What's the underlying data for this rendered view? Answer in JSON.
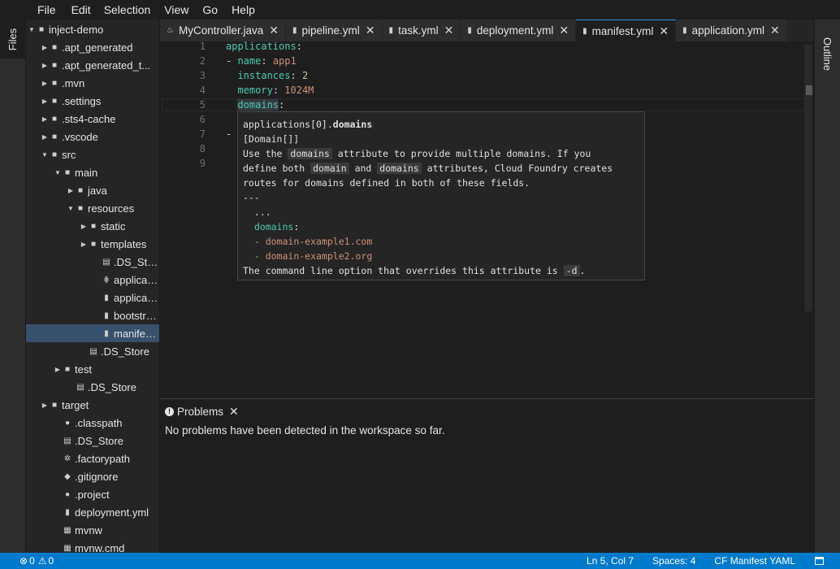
{
  "menu": [
    "File",
    "Edit",
    "Selection",
    "View",
    "Go",
    "Help"
  ],
  "left_rail": {
    "label": "Files"
  },
  "right_rail": {
    "label": "Outline"
  },
  "explorer": {
    "items": [
      {
        "label": "inject-demo",
        "depth": 0,
        "twisty": "open",
        "icon": "folder"
      },
      {
        "label": ".apt_generated",
        "depth": 1,
        "twisty": "closed",
        "icon": "folder"
      },
      {
        "label": ".apt_generated_t...",
        "depth": 1,
        "twisty": "closed",
        "icon": "folder"
      },
      {
        "label": ".mvn",
        "depth": 1,
        "twisty": "closed",
        "icon": "folder"
      },
      {
        "label": ".settings",
        "depth": 1,
        "twisty": "closed",
        "icon": "folder"
      },
      {
        "label": ".sts4-cache",
        "depth": 1,
        "twisty": "closed",
        "icon": "folder"
      },
      {
        "label": ".vscode",
        "depth": 1,
        "twisty": "closed",
        "icon": "folder"
      },
      {
        "label": "src",
        "depth": 1,
        "twisty": "open",
        "icon": "folder"
      },
      {
        "label": "main",
        "depth": 2,
        "twisty": "open",
        "icon": "folder"
      },
      {
        "label": "java",
        "depth": 3,
        "twisty": "closed",
        "icon": "folder"
      },
      {
        "label": "resources",
        "depth": 3,
        "twisty": "open",
        "icon": "folder"
      },
      {
        "label": "static",
        "depth": 4,
        "twisty": "closed",
        "icon": "folder"
      },
      {
        "label": "templates",
        "depth": 4,
        "twisty": "closed",
        "icon": "folder"
      },
      {
        "label": ".DS_Store",
        "depth": 5,
        "twisty": "",
        "icon": "file"
      },
      {
        "label": "applicati...",
        "depth": 5,
        "twisty": "",
        "icon": "settings-file"
      },
      {
        "label": "applicati...",
        "depth": 5,
        "twisty": "",
        "icon": "db-file"
      },
      {
        "label": "bootstra...",
        "depth": 5,
        "twisty": "",
        "icon": "db-file"
      },
      {
        "label": "manifest....",
        "depth": 5,
        "twisty": "",
        "icon": "db-file",
        "selected": true
      },
      {
        "label": ".DS_Store",
        "depth": 4,
        "twisty": "",
        "icon": "file"
      },
      {
        "label": "test",
        "depth": 2,
        "twisty": "closed",
        "icon": "folder"
      },
      {
        "label": ".DS_Store",
        "depth": 3,
        "twisty": "",
        "icon": "file"
      },
      {
        "label": "target",
        "depth": 1,
        "twisty": "closed",
        "icon": "folder"
      },
      {
        "label": ".classpath",
        "depth": 2,
        "twisty": "",
        "icon": "circle-file"
      },
      {
        "label": ".DS_Store",
        "depth": 2,
        "twisty": "",
        "icon": "file"
      },
      {
        "label": ".factorypath",
        "depth": 2,
        "twisty": "",
        "icon": "gear-file"
      },
      {
        "label": ".gitignore",
        "depth": 2,
        "twisty": "",
        "icon": "git-file"
      },
      {
        "label": ".project",
        "depth": 2,
        "twisty": "",
        "icon": "circle-file"
      },
      {
        "label": "deployment.yml",
        "depth": 2,
        "twisty": "",
        "icon": "db-file"
      },
      {
        "label": "mvnw",
        "depth": 2,
        "twisty": "",
        "icon": "grid-file"
      },
      {
        "label": "mvnw.cmd",
        "depth": 2,
        "twisty": "",
        "icon": "grid-file"
      }
    ]
  },
  "tabs": [
    {
      "label": "MyController.java",
      "icon": "java-icon",
      "active": false
    },
    {
      "label": "pipeline.yml",
      "icon": "db-icon",
      "active": false
    },
    {
      "label": "task.yml",
      "icon": "db-icon",
      "active": false
    },
    {
      "label": "deployment.yml",
      "icon": "db-icon",
      "active": false
    },
    {
      "label": "manifest.yml",
      "icon": "db-icon",
      "active": true
    },
    {
      "label": "application.yml",
      "icon": "db-icon",
      "active": false
    }
  ],
  "editor": {
    "line_numbers": [
      "1",
      "2",
      "3",
      "4",
      "5",
      "6",
      "7",
      "8",
      "9"
    ],
    "code": [
      [
        {
          "t": "applications",
          "c": "k"
        },
        {
          "t": ":",
          "c": "d"
        }
      ],
      [
        {
          "t": "- ",
          "c": "d"
        },
        {
          "t": "name",
          "c": "k"
        },
        {
          "t": ": ",
          "c": "d"
        },
        {
          "t": "app1",
          "c": "v"
        }
      ],
      [
        {
          "t": "  ",
          "c": "d"
        },
        {
          "t": "instances",
          "c": "k"
        },
        {
          "t": ": ",
          "c": "d"
        },
        {
          "t": "2",
          "c": "n"
        }
      ],
      [
        {
          "t": "  ",
          "c": "d"
        },
        {
          "t": "memory",
          "c": "k"
        },
        {
          "t": ": ",
          "c": "d"
        },
        {
          "t": "1024M",
          "c": "v"
        }
      ],
      [
        {
          "t": "  ",
          "c": "d"
        },
        {
          "t": "domains",
          "c": "k hl"
        },
        {
          "t": ":",
          "c": "d"
        }
      ],
      [],
      [
        {
          "t": "-",
          "c": "d"
        }
      ],
      [],
      []
    ]
  },
  "hover": {
    "path_prefix": "applications[0].",
    "path_bold": "domains",
    "type": "[Domain[]]",
    "desc1_a": "Use the ",
    "desc1_chip": "domains",
    "desc1_b": " attribute to provide multiple domains. If you",
    "desc2_a": "define both ",
    "desc2_chip1": "domain",
    "desc2_mid": " and ",
    "desc2_chip2": "domains",
    "desc2_b": " attributes, Cloud Foundry creates",
    "desc3": "routes for domains defined in both of these fields.",
    "rule": "---",
    "ex1": "  ...",
    "ex2_key": "domains",
    "ex2_colon": ":",
    "ex3_dash": "  - ",
    "ex3_val": "domain-example1.com",
    "ex4_dash": "  - ",
    "ex4_val": "domain-example2.org",
    "footer_a": "The command line option that overrides this attribute is ",
    "footer_chip": "-d",
    "footer_b": "."
  },
  "panel": {
    "tab_label": "Problems",
    "message": "No problems have been detected in the workspace so far."
  },
  "status": {
    "errors": "0",
    "warnings": "0",
    "position": "Ln 5, Col 7",
    "spaces": "Spaces: 4",
    "language": "CF Manifest YAML"
  }
}
